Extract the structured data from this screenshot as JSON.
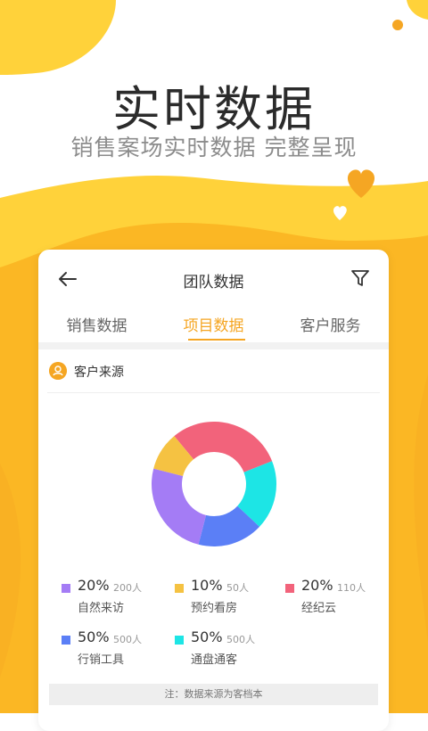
{
  "hero": {
    "title": "实时数据",
    "subtitle": "销售案场实时数据  完整呈现"
  },
  "card": {
    "title": "团队数据",
    "tabs": [
      {
        "label": "销售数据",
        "active": false
      },
      {
        "label": "项目数据",
        "active": true
      },
      {
        "label": "客户服务",
        "active": false
      }
    ],
    "section_title": "客户来源",
    "legend": [
      {
        "percent": "20%",
        "count": "200人",
        "label": "自然来访",
        "color": "#a47cf5"
      },
      {
        "percent": "10%",
        "count": "50人",
        "label": "预约看房",
        "color": "#f5c242"
      },
      {
        "percent": "20%",
        "count": "110人",
        "label": "经纪云",
        "color": "#f2637b"
      },
      {
        "percent": "50%",
        "count": "500人",
        "label": "行销工具",
        "color": "#5b7ff6"
      },
      {
        "percent": "50%",
        "count": "500人",
        "label": "通盘通客",
        "color": "#1de5e5"
      }
    ],
    "note": "注：数据来源为客档本"
  },
  "chart_data": {
    "type": "pie",
    "donut": true,
    "slices": [
      {
        "label": "经纪云",
        "value": 30,
        "color": "#f2637b"
      },
      {
        "label": "通盘通客",
        "value": 18,
        "color": "#1de5e5"
      },
      {
        "label": "行销工具",
        "value": 17,
        "color": "#5b7ff6"
      },
      {
        "label": "自然来访",
        "value": 25,
        "color": "#a47cf5"
      },
      {
        "label": "预约看房",
        "value": 10,
        "color": "#f5c242"
      }
    ]
  },
  "colors": {
    "accent": "#f5a623",
    "background_yellow": "#ffd23a"
  },
  "icons": {
    "back": "arrow-left-icon",
    "filter": "funnel-icon",
    "section": "user-icon",
    "decor": "heart-icon"
  }
}
